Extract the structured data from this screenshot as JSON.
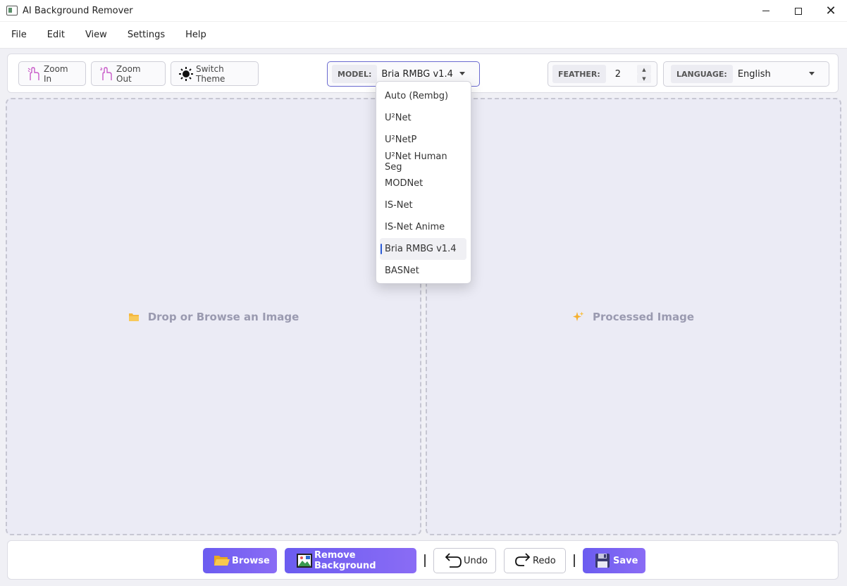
{
  "window": {
    "title": "AI Background Remover"
  },
  "menu": [
    "File",
    "Edit",
    "View",
    "Settings",
    "Help"
  ],
  "toolbar": {
    "zoom_in": "Zoom In",
    "zoom_out": "Zoom Out",
    "switch_theme": "Switch Theme",
    "model_label": "MODEL:",
    "model_value": "Bria RMBG v1.4",
    "feather_label": "FEATHER:",
    "feather_value": "2",
    "language_label": "LANGUAGE:",
    "language_value": "English"
  },
  "model_options": [
    "Auto (Rembg)",
    "U²Net",
    "U²NetP",
    "U²Net Human Seg",
    "MODNet",
    "IS-Net",
    "IS-Net Anime",
    "Bria RMBG v1.4",
    "BASNet"
  ],
  "selected_model_index": 7,
  "panels": {
    "left": "Drop or Browse an Image",
    "right": "Processed Image"
  },
  "bottom": {
    "browse": "Browse",
    "remove_bg": "Remove Background",
    "undo": "Undo",
    "redo": "Redo",
    "save": "Save"
  },
  "colors": {
    "accent": "#7a64f2",
    "select_marker": "#2a5bd7",
    "panel_bg": "#ebebf5"
  }
}
